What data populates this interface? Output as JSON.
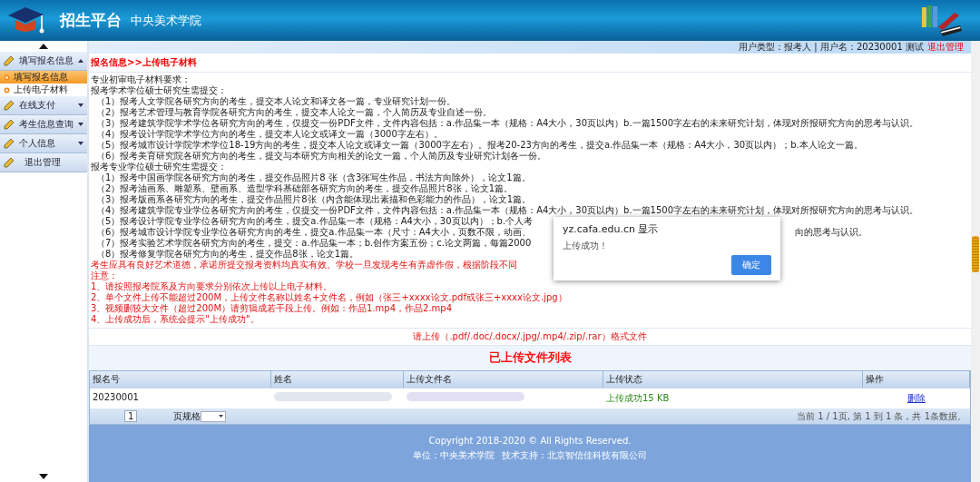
{
  "header": {
    "title": "招生平台",
    "subtitle": "中央美术学院"
  },
  "sidebar": {
    "groups": [
      {
        "label": "填写报名信息",
        "kind": "group",
        "expanded": true,
        "children": [
          {
            "label": "填写报名信息",
            "selected": true
          },
          {
            "label": "上传电子材料",
            "selected": false
          }
        ]
      },
      {
        "label": "在线支付",
        "kind": "group",
        "expanded": false
      },
      {
        "label": "考生信息查询",
        "kind": "group",
        "expanded": false
      },
      {
        "label": "个人信息",
        "kind": "group",
        "expanded": false
      },
      {
        "label": "退出管理",
        "kind": "link"
      }
    ]
  },
  "user_bar": {
    "info": "用户类型：报考人 | 用户名：20230001 测试",
    "logout": "退出管理"
  },
  "breadcrumb": "报名信息>>上传电子材料",
  "requirements": [
    {
      "kind": "heading",
      "text": "专业初审电子材料要求："
    },
    {
      "kind": "heading",
      "text": "报考学术学位硕士研究生需提交："
    },
    {
      "kind": "item",
      "text": "（1）报考人文学院各研究方向的考生，提交本人论文和译文各一篇，专业研究计划一份。"
    },
    {
      "kind": "item",
      "text": "（2）报考艺术管理与教育学院各研究方向的考生，提交本人论文一篇，个人简历及专业自述一份。"
    },
    {
      "kind": "item",
      "text": "（3）报考建筑学院学术学位各研究方向的考生，仅提交一份PDF文件，文件内容包括：a.作品集一本（规格：A4大小，30页以内）b.一篇1500字左右的未来研究计划，体现对所报研究方向的思考与认识。"
    },
    {
      "kind": "item",
      "text": "（4）报考设计学院学术学位方向的考生，提交本人论文或译文一篇（3000字左右）。"
    },
    {
      "kind": "item",
      "text": "（5）报考城市设计学院学术学位18-19方向的考生，提交本人论文或译文一篇（3000字左右）。报考20-23方向的考生，提交a.作品集一本（规格：A4大小，30页以内）；b.本人论文一篇。"
    },
    {
      "kind": "item",
      "text": "（6）报考美育研究院各研究方向的考生，提交与本研究方向相关的论文一篇，个人简历及专业研究计划各一份。"
    },
    {
      "kind": "heading",
      "text": "报考专业学位硕士研究生需提交："
    },
    {
      "kind": "item",
      "text": "（1）报考中国画学院各研究方向的考生，提交作品照片8 张（含3张写生作品，书法方向除外），论文1篇。"
    },
    {
      "kind": "item",
      "text": "（2）报考油画系、雕塑系、壁画系、造型学科基础部各研究方向的考生，提交作品照片8张，论文1篇。"
    },
    {
      "kind": "item",
      "text": "（3）报考版画系各研究方向的考生，提交作品照片8张（内含能体现出素描和色彩能力的作品），论文1篇。"
    },
    {
      "kind": "item",
      "text": "（4）报考建筑学院专业学位各研究方向的考生，仅提交一份PDF文件，文件内容包括：a.作品集一本（规格：A4大小，30页以内）b.一篇1500字左右的未来研究计划，体现对所报研究方向的思考与认识。"
    },
    {
      "kind": "item",
      "text": "（5）报考设计学院专业学位各研究方向的考生，提交a.作品集一本（规格：A4大小，30页以内）；b.个人考"
    },
    {
      "kind": "item",
      "text": "（6）报考城市设计学院专业学位各研究方向的考生，提交a.作品集一本（尺寸：A4大小，页数不限，动画、",
      "tail": "向的思考与认识。"
    },
    {
      "kind": "item",
      "text": "（7）报考实验艺术学院各研究方向的考生，提交：a.作品集一本；b.创作方案五份；c.论文两篇，每篇2000"
    },
    {
      "kind": "item",
      "text": "（8）报考修复学院各研究方向的考生，提交作品8张，论文1篇。"
    },
    {
      "kind": "warning",
      "text": "考生应具有良好艺术道德，承诺所提交报考资料均真实有效。学校一旦发现考生有弄虚作假，根据阶段不同"
    },
    {
      "kind": "warning",
      "text": "注意："
    },
    {
      "kind": "warning",
      "text": "1、请按照报考院系及方向要求分别依次上传以上电子材料。"
    },
    {
      "kind": "warning",
      "text": "2、单个文件上传不能超过200M，上传文件名称以姓名+文件名，例如（张三+xxxx论文.pdf或张三+xxxx论文.jpg）"
    },
    {
      "kind": "warning",
      "text": "3、视频删较大文件（超过200M）请剪辑成若干段上传。例如：作品1.mp4，作品2.mp4"
    },
    {
      "kind": "warning",
      "text": "4、上传成功后，系统会提示\"上传成功\"。"
    }
  ],
  "upload_note": "请上传（.pdf/.doc/.docx/.jpg/.mp4/.zip/.rar）格式文件",
  "list_title": "已上传文件列表",
  "table": {
    "columns": [
      "报名号",
      "姓名",
      "上传文件名",
      "上传状态",
      "操作"
    ],
    "rows": [
      {
        "id": "20230001",
        "status": "上传成功15 KB",
        "action": "删除"
      }
    ]
  },
  "pager": {
    "page": "1",
    "size_label": "页规格",
    "summary": "当前 1 / 1页, 第 1 到 1 条，共 1条数据。"
  },
  "footer": {
    "copyright": "Copyright 2018-2020 © All Rights Reserved.",
    "unit": "单位：中央美术学院",
    "support": "技术支持：北京智信佳科技有限公司"
  },
  "dialog": {
    "title": "yz.cafa.edu.cn 显示",
    "message": "上传成功！",
    "button": "确定"
  }
}
